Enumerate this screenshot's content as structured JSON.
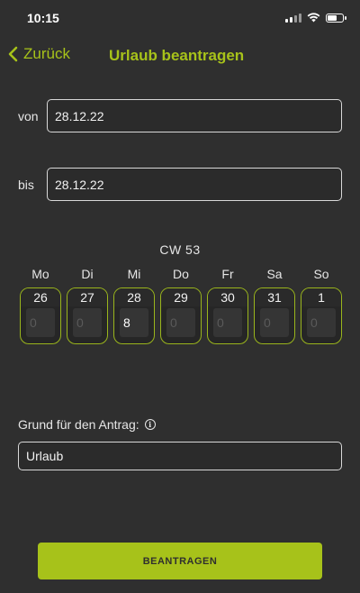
{
  "status_bar": {
    "time": "10:15"
  },
  "nav": {
    "back_label": "Zurück",
    "title": "Urlaub beantragen"
  },
  "from": {
    "label": "von",
    "value": "28.12.22"
  },
  "to": {
    "label": "bis",
    "value": "28.12.22"
  },
  "week": {
    "label": "CW  53",
    "days": [
      {
        "name": "Mo",
        "date": "26",
        "hours": "0"
      },
      {
        "name": "Di",
        "date": "27",
        "hours": "0"
      },
      {
        "name": "Mi",
        "date": "28",
        "hours": "8"
      },
      {
        "name": "Do",
        "date": "29",
        "hours": "0"
      },
      {
        "name": "Fr",
        "date": "30",
        "hours": "0"
      },
      {
        "name": "Sa",
        "date": "31",
        "hours": "0"
      },
      {
        "name": "So",
        "date": "1",
        "hours": "0"
      }
    ]
  },
  "reason": {
    "label": "Grund für den Antrag:",
    "value": "Urlaub"
  },
  "submit_label": "BEANTRAGEN",
  "colors": {
    "accent": "#a7c21a",
    "background": "#2f2f2f"
  },
  "icons": {
    "back": "chevron-left-icon",
    "info": "info-icon",
    "signal": "cellular-signal-icon",
    "wifi": "wifi-icon",
    "battery": "battery-icon"
  }
}
